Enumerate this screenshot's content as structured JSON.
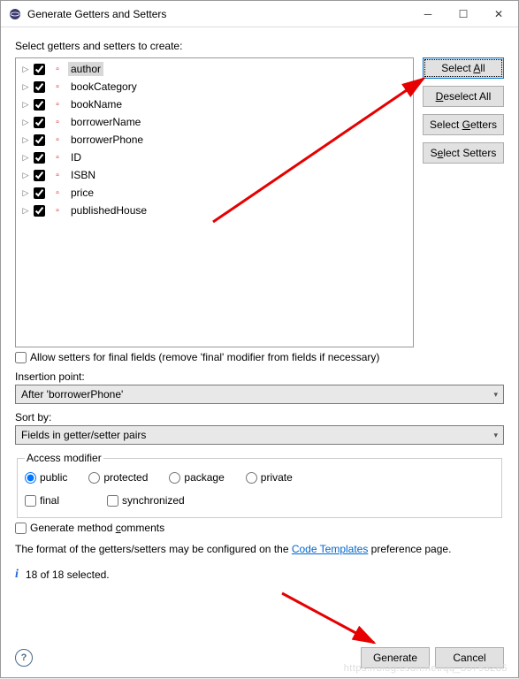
{
  "window": {
    "title": "Generate Getters and Setters"
  },
  "instruction": "Select getters and setters to create:",
  "fields": [
    {
      "name": "author",
      "selected": true
    },
    {
      "name": "bookCategory",
      "selected": false
    },
    {
      "name": "bookName",
      "selected": false
    },
    {
      "name": "borrowerName",
      "selected": false
    },
    {
      "name": "borrowerPhone",
      "selected": false
    },
    {
      "name": "ID",
      "selected": false
    },
    {
      "name": "ISBN",
      "selected": false
    },
    {
      "name": "price",
      "selected": false
    },
    {
      "name": "publishedHouse",
      "selected": false
    }
  ],
  "sideButtons": {
    "selectAll": {
      "pre": "Select ",
      "u": "A",
      "post": "ll"
    },
    "deselectAll": {
      "pre": "",
      "u": "D",
      "post": "eselect All"
    },
    "selectGetters": {
      "pre": "Select ",
      "u": "G",
      "post": "etters"
    },
    "selectSetters": {
      "pre": "S",
      "u": "e",
      "post": "lect Setters"
    }
  },
  "allowFinal": "Allow setters for final fields (remove 'final' modifier from fields if necessary)",
  "insertionLabel": "Insertion point:",
  "insertionValue": "After 'borrowerPhone'",
  "sortLabel": "Sort by:",
  "sortValue": "Fields in getter/setter pairs",
  "accessModifier": {
    "legend": "Access modifier",
    "public": "public",
    "protected": "protected",
    "package": "package",
    "private": "private",
    "final": "final",
    "synchronized": "synchronized"
  },
  "generateComments": {
    "pre": "Generate method ",
    "u": "c",
    "post": "omments"
  },
  "formatText": {
    "pre": "The format of the getters/setters may be configured on the ",
    "link": "Code Templates",
    "post": " preference page."
  },
  "status": "18 of 18 selected.",
  "actions": {
    "generate": "Generate",
    "cancel": "Cancel"
  },
  "watermark": "https://blog.csdn.net/qq_35793285"
}
